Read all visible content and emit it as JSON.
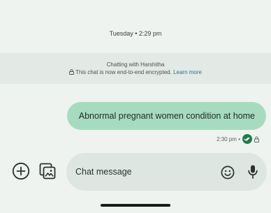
{
  "header": {
    "date_time": "Tuesday • 2:29 pm"
  },
  "encryption_banner": {
    "chatting_with": "Chatting with Harshitha",
    "notice": "This chat is now end-to-end encrypted.",
    "learn_more": "Learn more"
  },
  "message": {
    "text": "Abnormal pregnant women condition at home",
    "time": "2:30 pm •",
    "status_icon": "double-check-icon"
  },
  "composer": {
    "placeholder": "Chat message",
    "icons": [
      "add-icon",
      "gallery-icon",
      "emoji-icon",
      "mic-icon"
    ]
  },
  "colors": {
    "background": "#eef3ef",
    "bubble": "#a7dbbf",
    "status_check": "#1f7a4d",
    "link": "#2f6f92"
  }
}
